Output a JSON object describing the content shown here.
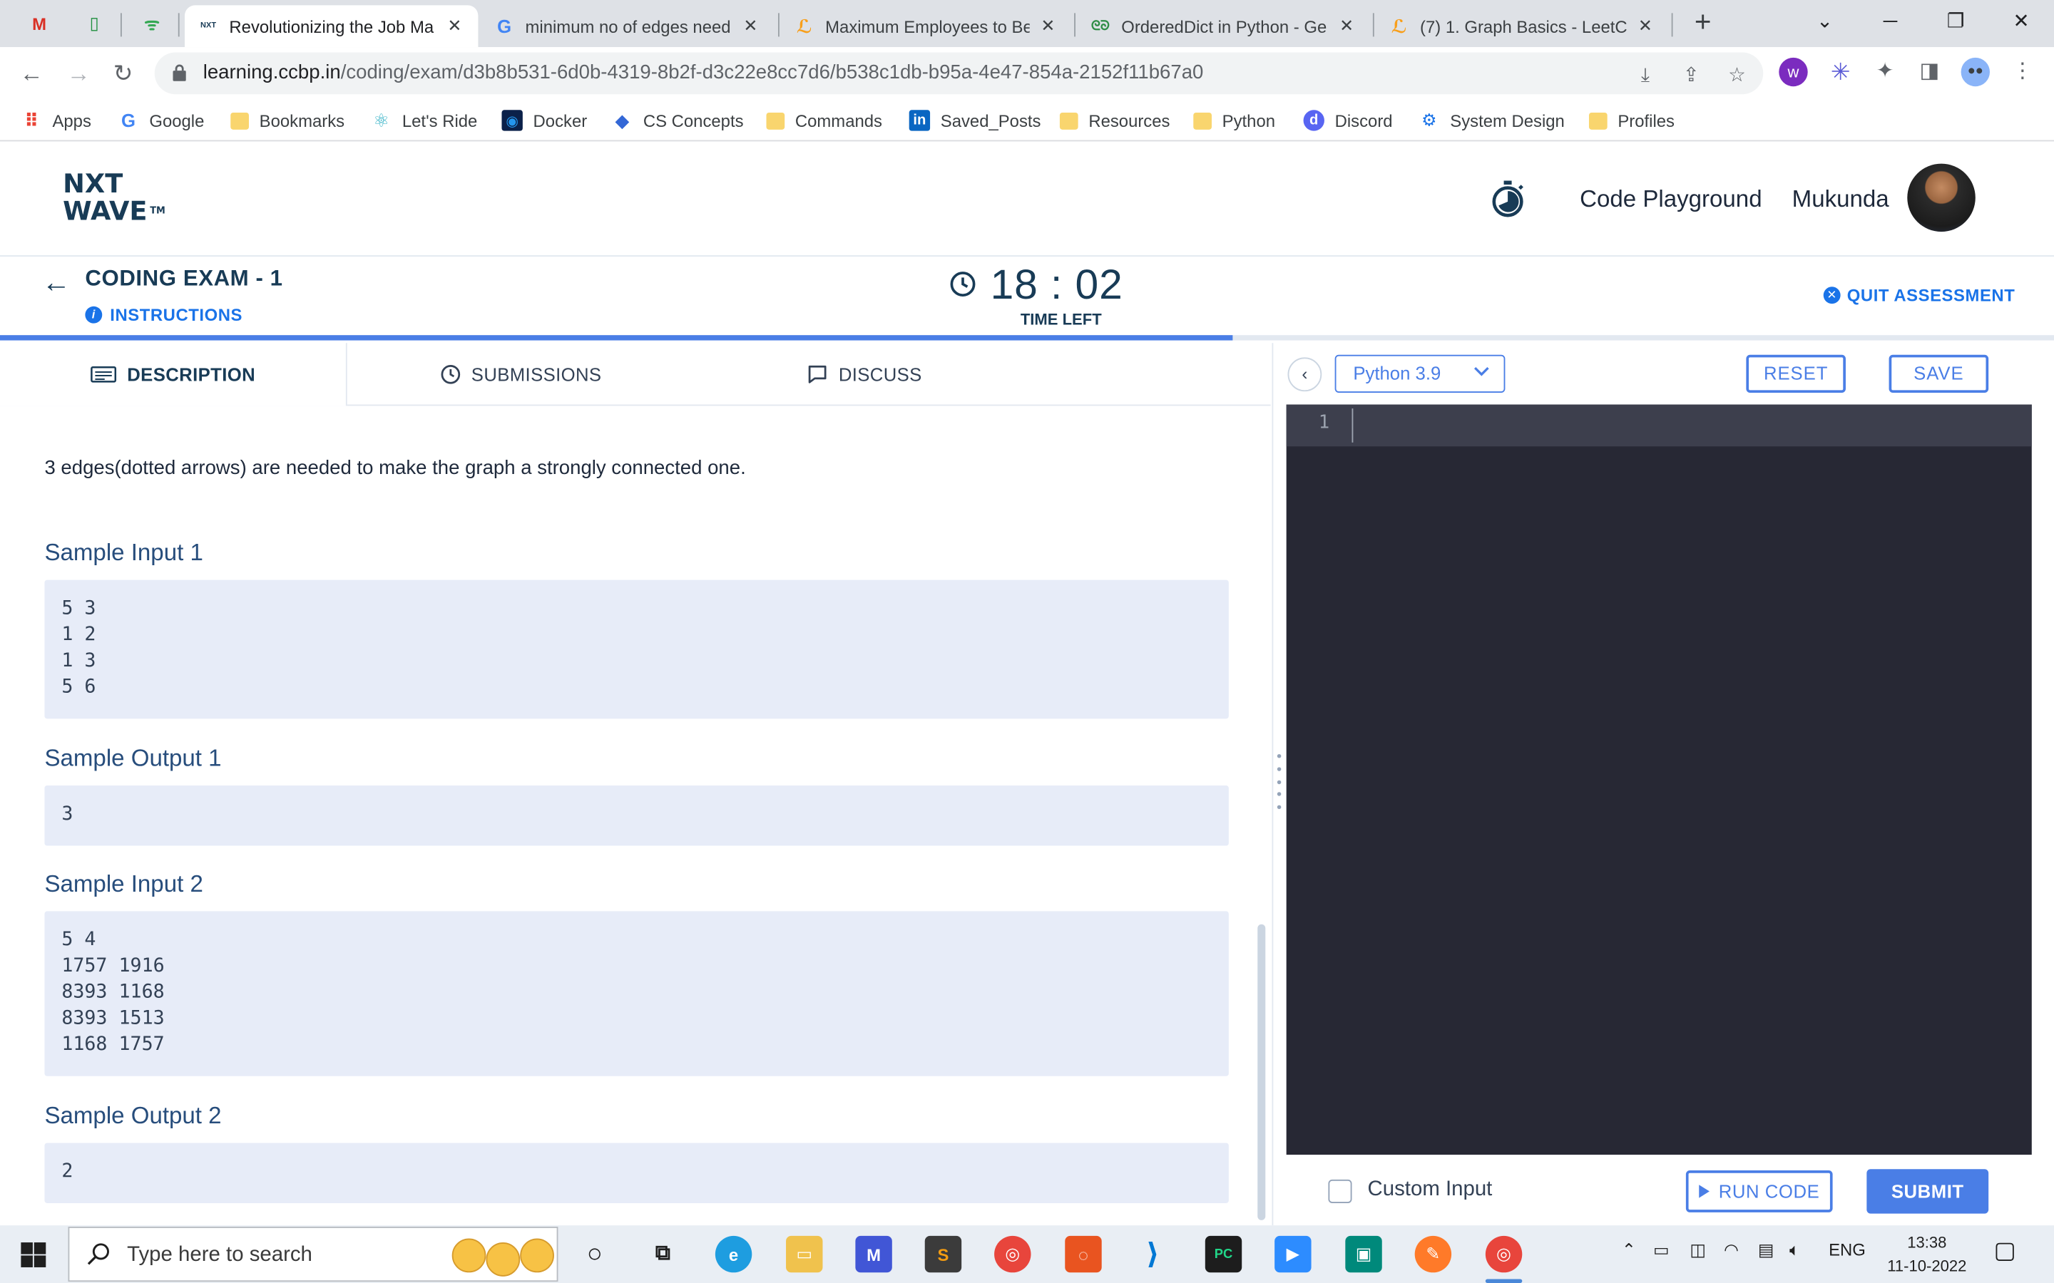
{
  "browser": {
    "pinned_tabs": [
      "M",
      "▯",
      "ᯤ"
    ],
    "tabs": [
      {
        "title": "Revolutionizing the Job Ma",
        "favicon": "NW",
        "active": true
      },
      {
        "title": "minimum no of edges need",
        "favicon": "G",
        "active": false
      },
      {
        "title": "Maximum Employees to Be",
        "favicon": "LC",
        "active": false
      },
      {
        "title": "OrderedDict in Python - Ge",
        "favicon": "GG",
        "active": false
      },
      {
        "title": "(7) 1. Graph Basics - LeetCo",
        "favicon": "LC",
        "active": false
      }
    ],
    "new_tab": "+",
    "url_host": "learning.ccbp.in",
    "url_path": "/coding/exam/d3b8b531-6d0b-4319-8b2f-d3c22e8cc7d6/b538c1db-b95a-4e47-854a-2152f11b67a0",
    "bookmarks": [
      {
        "label": "Apps",
        "icon": "apps-grid"
      },
      {
        "label": "Google",
        "icon": "google"
      },
      {
        "label": "Bookmarks",
        "icon": "folder"
      },
      {
        "label": "Let's Ride",
        "icon": "react"
      },
      {
        "label": "Docker",
        "icon": "docker"
      },
      {
        "label": "CS Concepts",
        "icon": "diamond"
      },
      {
        "label": "Commands",
        "icon": "folder"
      },
      {
        "label": "Saved_Posts",
        "icon": "linkedin"
      },
      {
        "label": "Resources",
        "icon": "folder"
      },
      {
        "label": "Python",
        "icon": "folder"
      },
      {
        "label": "Discord",
        "icon": "discord"
      },
      {
        "label": "System Design",
        "icon": "system-design"
      },
      {
        "label": "Profiles",
        "icon": "folder"
      }
    ]
  },
  "header": {
    "logo_line1": "NXT",
    "logo_line2": "WAVE",
    "logo_tm": "TM",
    "code_playground": "Code Playground",
    "user_name": "Mukunda"
  },
  "exam": {
    "title": "CODING EXAM - 1",
    "instructions": "INSTRUCTIONS",
    "timer": "18 : 02",
    "time_left_label": "TIME LEFT",
    "quit": "QUIT ASSESSMENT",
    "progress_fraction": 0.6
  },
  "panel": {
    "tabs": [
      "DESCRIPTION",
      "SUBMISSIONS",
      "DISCUSS"
    ],
    "desc_text": "3 edges(dotted arrows) are needed to make the graph a strongly connected one.",
    "sample_input_1_label": "Sample Input 1",
    "sample_input_1": "5 3\n1 2\n1 3\n5 6",
    "sample_output_1_label": "Sample Output 1",
    "sample_output_1": "3",
    "sample_input_2_label": "Sample Input 2",
    "sample_input_2": "5 4\n1757 1916\n8393 1168\n8393 1513\n1168 1757",
    "sample_output_2_label": "Sample Output 2",
    "sample_output_2": "2"
  },
  "editor": {
    "language": "Python 3.9",
    "reset": "RESET",
    "save": "SAVE",
    "line_number": "1",
    "custom_input": "Custom Input",
    "run_code": "RUN CODE",
    "submit": "SUBMIT",
    "accent": "#4a7ee6"
  },
  "taskbar": {
    "search_placeholder": "Type here to search",
    "language": "ENG",
    "time": "13:38",
    "date": "11-10-2022"
  }
}
